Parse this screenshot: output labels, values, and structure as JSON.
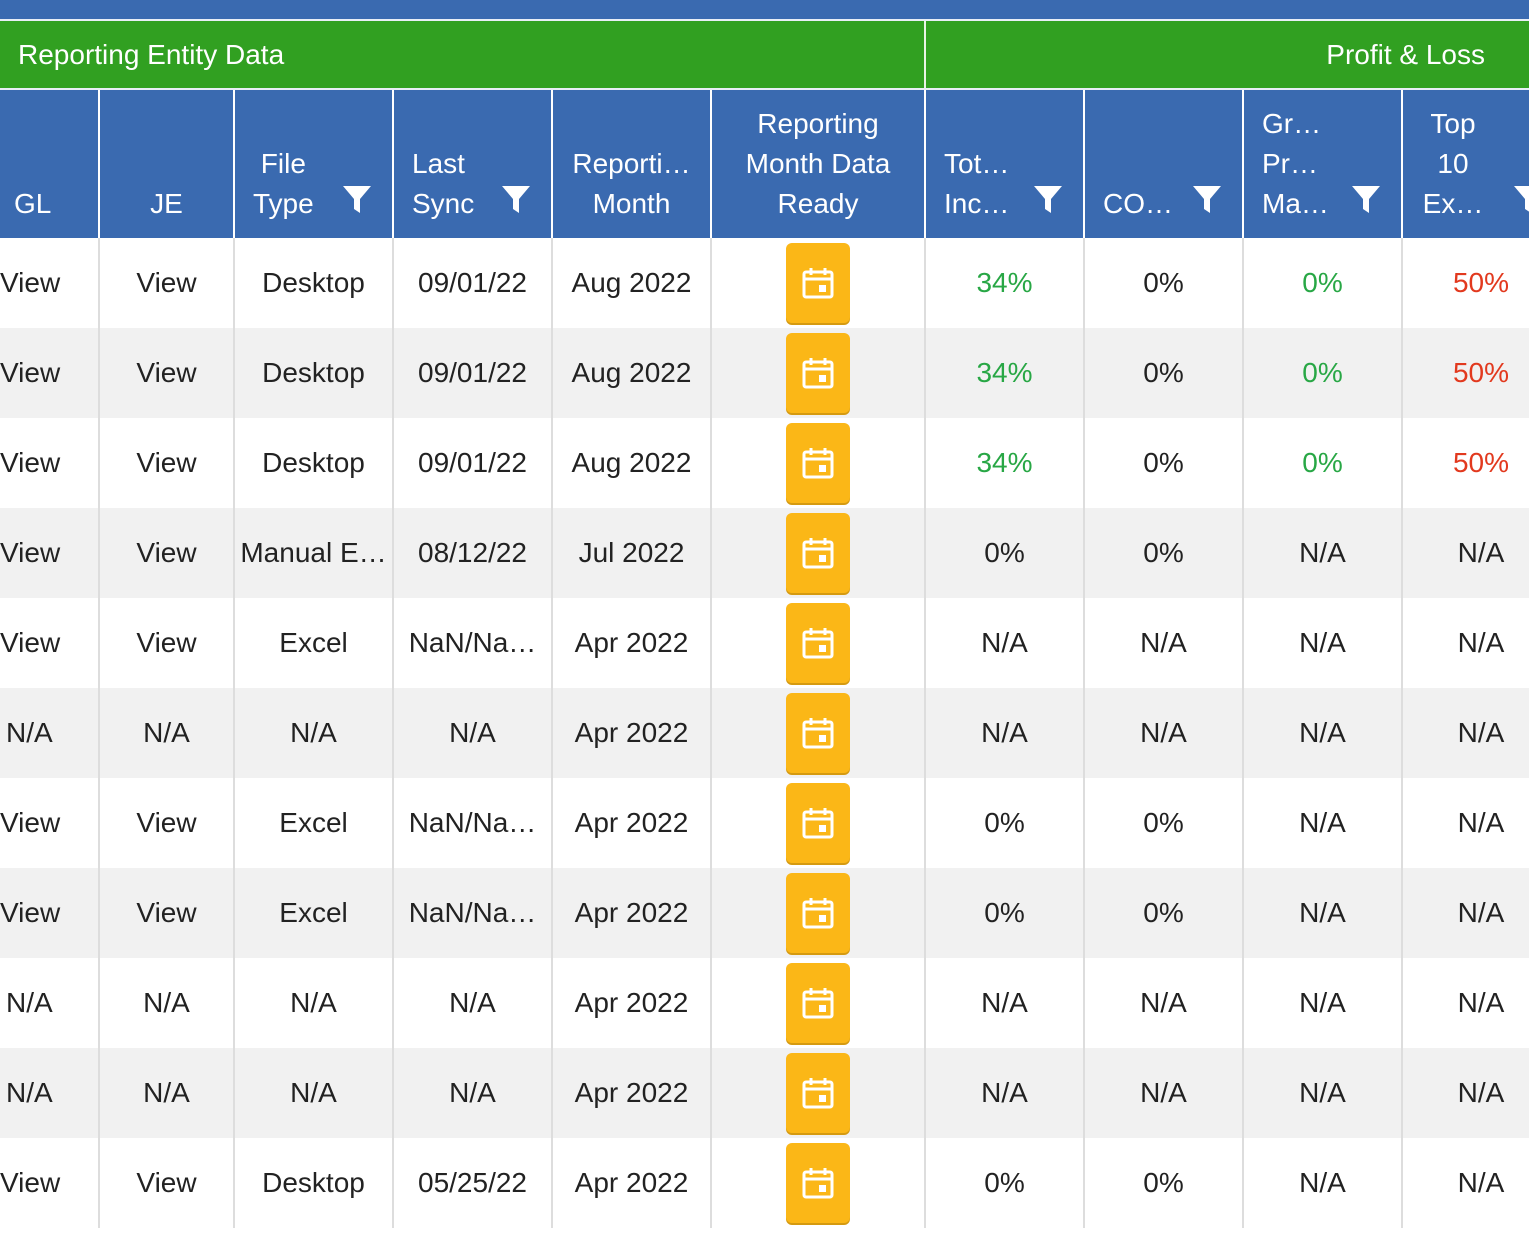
{
  "colors": {
    "header_blue": "#3a6ab0",
    "group_green": "#31a021",
    "calendar_yellow": "#fbb717",
    "positive_green": "#28a745",
    "negative_red": "#e2391e",
    "alt_row": "#f1f1f1"
  },
  "groups": {
    "reporting_entity": "Reporting Entity Data",
    "profit_loss": "Profit & Loss"
  },
  "columns": {
    "gl": "GL",
    "je": "JE",
    "file_type": "File\nType",
    "last_sync": "Last\nSync",
    "reporting_month": "Reporti…\nMonth",
    "month_data_ready": "Reporting\nMonth Data\nReady",
    "total_income": "Tot…\nInc…",
    "cogs": "CO…",
    "gross_profit_margin": "Gr…\nPr…\nMa…",
    "top10_expenses": "Top\n10\nEx…"
  },
  "icons": {
    "filter": "filter-funnel-icon",
    "calendar": "calendar-icon"
  },
  "rows": [
    {
      "gl": "View",
      "je": "View",
      "file_type": "Desktop",
      "last_sync": "09/01/22",
      "month": "Aug 2022",
      "tot_inc": "34%",
      "tot_inc_status": "green",
      "cogs": "0%",
      "cogs_status": "neutral",
      "gpm": "0%",
      "gpm_status": "green",
      "top10": "50%",
      "top10_status": "red"
    },
    {
      "gl": "View",
      "je": "View",
      "file_type": "Desktop",
      "last_sync": "09/01/22",
      "month": "Aug 2022",
      "tot_inc": "34%",
      "tot_inc_status": "green",
      "cogs": "0%",
      "cogs_status": "neutral",
      "gpm": "0%",
      "gpm_status": "green",
      "top10": "50%",
      "top10_status": "red"
    },
    {
      "gl": "View",
      "je": "View",
      "file_type": "Desktop",
      "last_sync": "09/01/22",
      "month": "Aug 2022",
      "tot_inc": "34%",
      "tot_inc_status": "green",
      "cogs": "0%",
      "cogs_status": "neutral",
      "gpm": "0%",
      "gpm_status": "green",
      "top10": "50%",
      "top10_status": "red"
    },
    {
      "gl": "View",
      "je": "View",
      "file_type": "Manual E…",
      "last_sync": "08/12/22",
      "month": "Jul 2022",
      "tot_inc": "0%",
      "tot_inc_status": "neutral",
      "cogs": "0%",
      "cogs_status": "neutral",
      "gpm": "N/A",
      "gpm_status": "neutral",
      "top10": "N/A",
      "top10_status": "neutral"
    },
    {
      "gl": "View",
      "je": "View",
      "file_type": "Excel",
      "last_sync": "NaN/Na…",
      "month": "Apr 2022",
      "tot_inc": "N/A",
      "tot_inc_status": "neutral",
      "cogs": "N/A",
      "cogs_status": "neutral",
      "gpm": "N/A",
      "gpm_status": "neutral",
      "top10": "N/A",
      "top10_status": "neutral"
    },
    {
      "gl": "N/A",
      "je": "N/A",
      "file_type": "N/A",
      "last_sync": "N/A",
      "month": "Apr 2022",
      "tot_inc": "N/A",
      "tot_inc_status": "neutral",
      "cogs": "N/A",
      "cogs_status": "neutral",
      "gpm": "N/A",
      "gpm_status": "neutral",
      "top10": "N/A",
      "top10_status": "neutral"
    },
    {
      "gl": "View",
      "je": "View",
      "file_type": "Excel",
      "last_sync": "NaN/Na…",
      "month": "Apr 2022",
      "tot_inc": "0%",
      "tot_inc_status": "neutral",
      "cogs": "0%",
      "cogs_status": "neutral",
      "gpm": "N/A",
      "gpm_status": "neutral",
      "top10": "N/A",
      "top10_status": "neutral"
    },
    {
      "gl": "View",
      "je": "View",
      "file_type": "Excel",
      "last_sync": "NaN/Na…",
      "month": "Apr 2022",
      "tot_inc": "0%",
      "tot_inc_status": "neutral",
      "cogs": "0%",
      "cogs_status": "neutral",
      "gpm": "N/A",
      "gpm_status": "neutral",
      "top10": "N/A",
      "top10_status": "neutral"
    },
    {
      "gl": "N/A",
      "je": "N/A",
      "file_type": "N/A",
      "last_sync": "N/A",
      "month": "Apr 2022",
      "tot_inc": "N/A",
      "tot_inc_status": "neutral",
      "cogs": "N/A",
      "cogs_status": "neutral",
      "gpm": "N/A",
      "gpm_status": "neutral",
      "top10": "N/A",
      "top10_status": "neutral"
    },
    {
      "gl": "N/A",
      "je": "N/A",
      "file_type": "N/A",
      "last_sync": "N/A",
      "month": "Apr 2022",
      "tot_inc": "N/A",
      "tot_inc_status": "neutral",
      "cogs": "N/A",
      "cogs_status": "neutral",
      "gpm": "N/A",
      "gpm_status": "neutral",
      "top10": "N/A",
      "top10_status": "neutral"
    },
    {
      "gl": "View",
      "je": "View",
      "file_type": "Desktop",
      "last_sync": "05/25/22",
      "month": "Apr 2022",
      "tot_inc": "0%",
      "tot_inc_status": "neutral",
      "cogs": "0%",
      "cogs_status": "neutral",
      "gpm": "N/A",
      "gpm_status": "neutral",
      "top10": "N/A",
      "top10_status": "neutral"
    }
  ]
}
